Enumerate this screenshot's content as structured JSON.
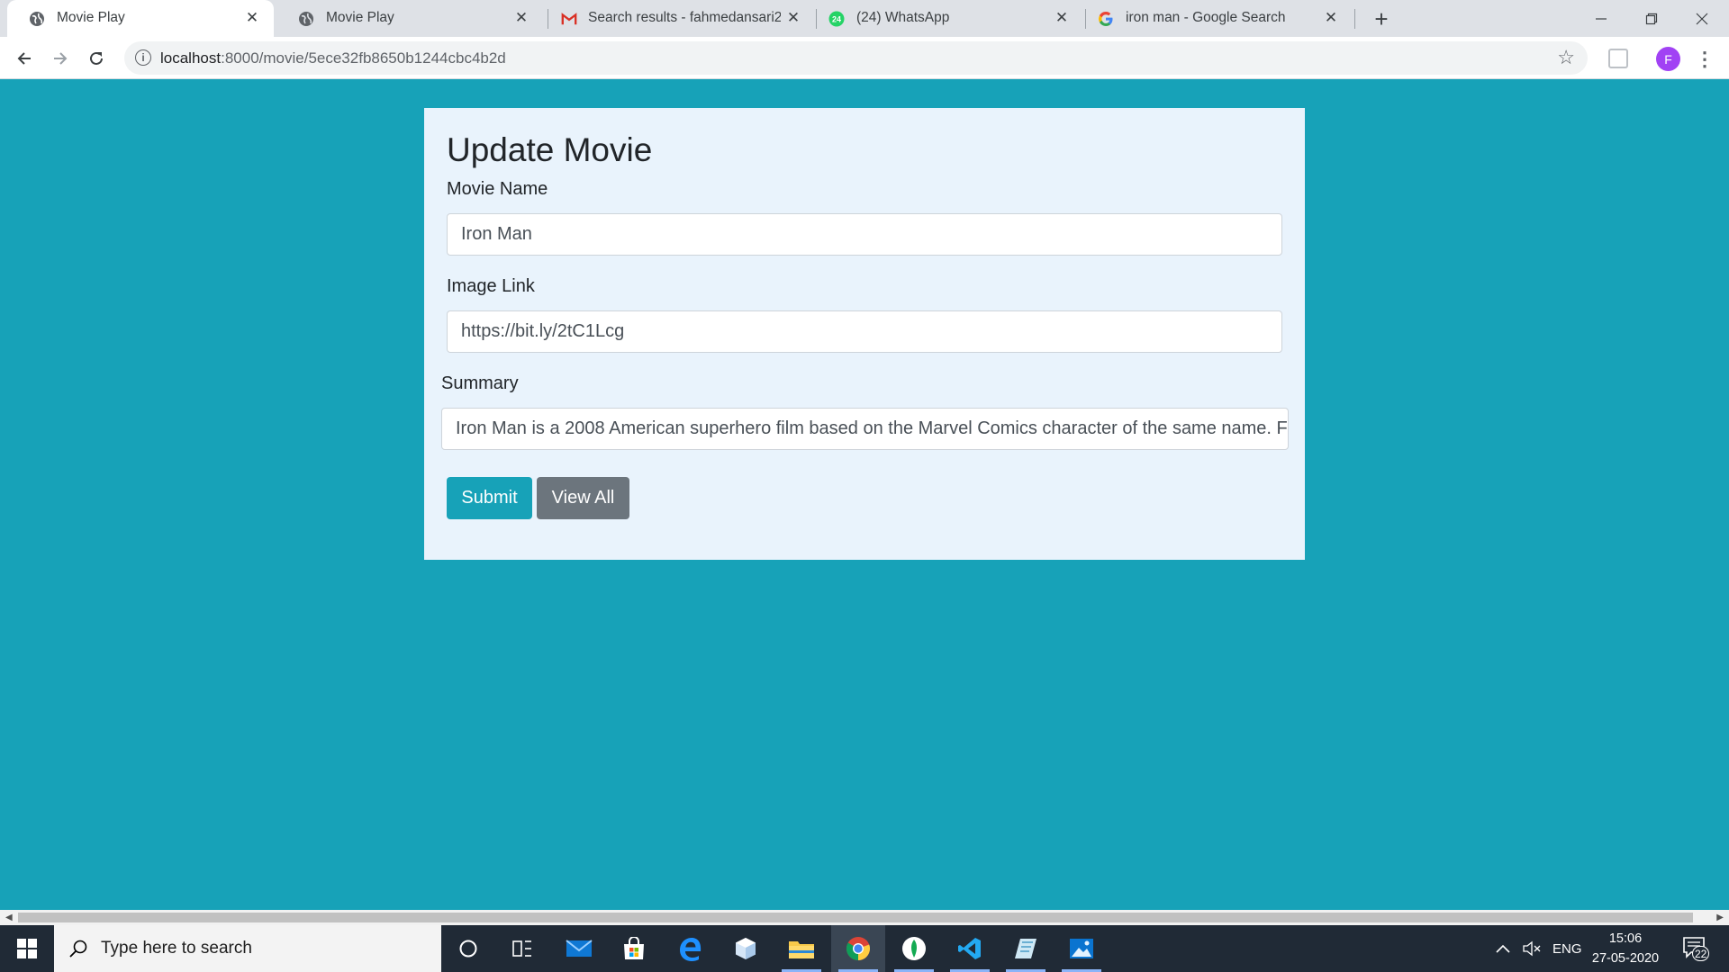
{
  "browser": {
    "tabs": [
      {
        "title": "Movie Play",
        "favicon": "globe-icon",
        "active": true
      },
      {
        "title": "Movie Play",
        "favicon": "globe-icon",
        "active": false
      },
      {
        "title": "Search results - fahmedansari20",
        "favicon": "gmail-icon",
        "active": false
      },
      {
        "title": "(24) WhatsApp",
        "favicon": "whatsapp-icon",
        "active": false
      },
      {
        "title": "iron man - Google Search",
        "favicon": "google-icon",
        "active": false
      }
    ],
    "whatsapp_badge": "24",
    "url_host": "localhost",
    "url_path": ":8000/movie/5ece32fb8650b1244cbc4b2d",
    "profile_initial": "F"
  },
  "page": {
    "heading": "Update Movie",
    "fields": {
      "movie_name": {
        "label": "Movie Name",
        "value": "Iron Man"
      },
      "image_link": {
        "label": "Image Link",
        "value": "https://bit.ly/2tC1Lcg"
      },
      "summary": {
        "label": "Summary",
        "value": "Iron Man is a 2008 American superhero film based on the Marvel Comics character of the same name. F"
      }
    },
    "buttons": {
      "submit": "Submit",
      "view_all": "View All"
    }
  },
  "taskbar": {
    "search_placeholder": "Type here to search",
    "language": "ENG",
    "time": "15:06",
    "date": "27-05-2020",
    "notification_count": "22"
  },
  "colors": {
    "page_background": "#17a2b8",
    "card_background": "#e9f3fc",
    "submit_button": "#17a2b8",
    "view_all_button": "#6c757d"
  }
}
